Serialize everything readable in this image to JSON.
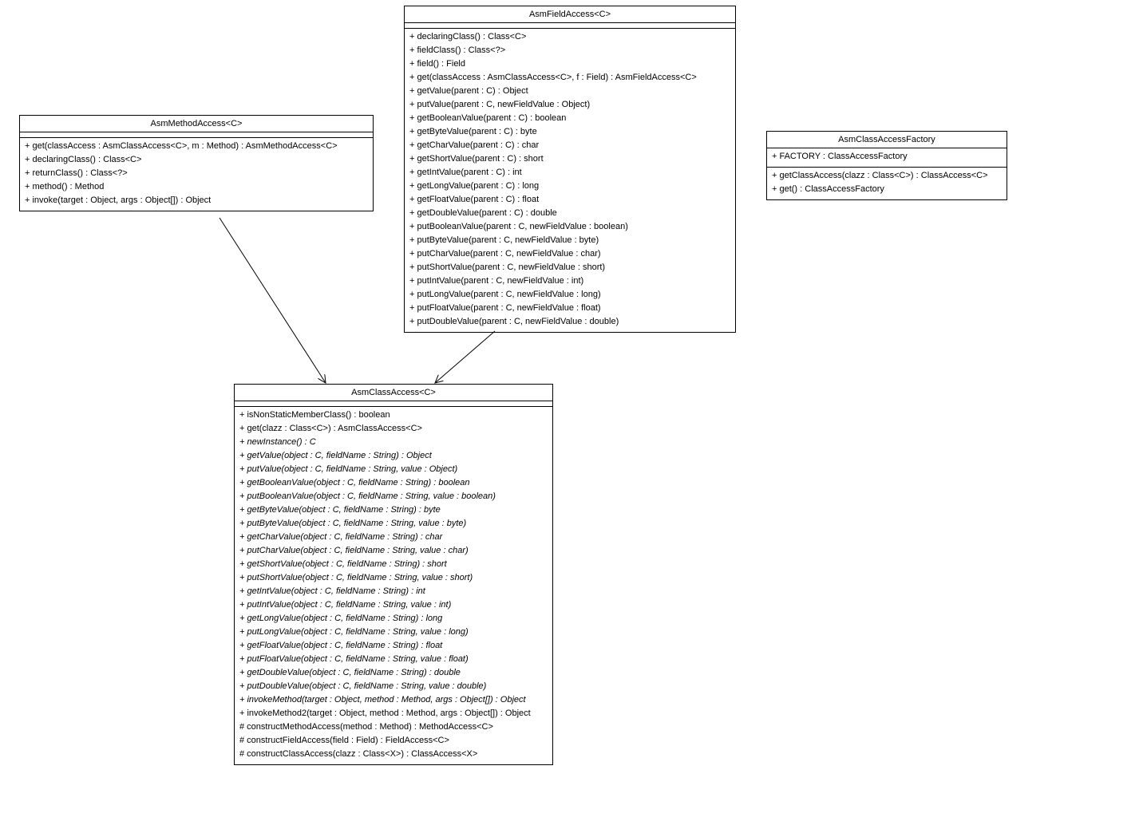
{
  "classes": {
    "asmMethodAccess": {
      "title": "AsmMethodAccess<C>",
      "ops": [
        {
          "text": "+ get(classAccess : AsmClassAccess<C>, m : Method) : AsmMethodAccess<C>",
          "italic": false
        },
        {
          "text": "+ declaringClass() : Class<C>",
          "italic": false
        },
        {
          "text": "+ returnClass() : Class<?>",
          "italic": false
        },
        {
          "text": "+ method() : Method",
          "italic": false
        },
        {
          "text": "+ invoke(target : Object, args : Object[]) : Object",
          "italic": false
        }
      ]
    },
    "asmFieldAccess": {
      "title": "AsmFieldAccess<C>",
      "ops": [
        {
          "text": "+ declaringClass() : Class<C>",
          "italic": false
        },
        {
          "text": "+ fieldClass() : Class<?>",
          "italic": false
        },
        {
          "text": "+ field() : Field",
          "italic": false
        },
        {
          "text": "+ get(classAccess : AsmClassAccess<C>, f : Field) : AsmFieldAccess<C>",
          "italic": false
        },
        {
          "text": "+ getValue(parent : C) : Object",
          "italic": false
        },
        {
          "text": "+ putValue(parent : C, newFieldValue : Object)",
          "italic": false
        },
        {
          "text": "+ getBooleanValue(parent : C) : boolean",
          "italic": false
        },
        {
          "text": "+ getByteValue(parent : C) : byte",
          "italic": false
        },
        {
          "text": "+ getCharValue(parent : C) : char",
          "italic": false
        },
        {
          "text": "+ getShortValue(parent : C) : short",
          "italic": false
        },
        {
          "text": "+ getIntValue(parent : C) : int",
          "italic": false
        },
        {
          "text": "+ getLongValue(parent : C) : long",
          "italic": false
        },
        {
          "text": "+ getFloatValue(parent : C) : float",
          "italic": false
        },
        {
          "text": "+ getDoubleValue(parent : C) : double",
          "italic": false
        },
        {
          "text": "+ putBooleanValue(parent : C, newFieldValue : boolean)",
          "italic": false
        },
        {
          "text": "+ putByteValue(parent : C, newFieldValue : byte)",
          "italic": false
        },
        {
          "text": "+ putCharValue(parent : C, newFieldValue : char)",
          "italic": false
        },
        {
          "text": "+ putShortValue(parent : C, newFieldValue : short)",
          "italic": false
        },
        {
          "text": "+ putIntValue(parent : C, newFieldValue : int)",
          "italic": false
        },
        {
          "text": "+ putLongValue(parent : C, newFieldValue : long)",
          "italic": false
        },
        {
          "text": "+ putFloatValue(parent : C, newFieldValue : float)",
          "italic": false
        },
        {
          "text": "+ putDoubleValue(parent : C, newFieldValue : double)",
          "italic": false
        }
      ]
    },
    "asmClassAccessFactory": {
      "title": "AsmClassAccessFactory",
      "attrs": [
        {
          "text": "+ FACTORY : ClassAccessFactory",
          "italic": false
        }
      ],
      "ops": [
        {
          "text": "+ getClassAccess(clazz : Class<C>) : ClassAccess<C>",
          "italic": false
        },
        {
          "text": "+ get() : ClassAccessFactory",
          "italic": false
        }
      ]
    },
    "asmClassAccess": {
      "title": "AsmClassAccess<C>",
      "ops": [
        {
          "text": "+ isNonStaticMemberClass() : boolean",
          "italic": false
        },
        {
          "text": "+ get(clazz : Class<C>) : AsmClassAccess<C>",
          "italic": false
        },
        {
          "text": "+ newInstance() : C",
          "italic": true
        },
        {
          "text": "+ getValue(object : C, fieldName : String) : Object",
          "italic": true
        },
        {
          "text": "+ putValue(object : C, fieldName : String, value : Object)",
          "italic": true
        },
        {
          "text": "+ getBooleanValue(object : C, fieldName : String) : boolean",
          "italic": true
        },
        {
          "text": "+ putBooleanValue(object : C, fieldName : String, value : boolean)",
          "italic": true
        },
        {
          "text": "+ getByteValue(object : C, fieldName : String) : byte",
          "italic": true
        },
        {
          "text": "+ putByteValue(object : C, fieldName : String, value : byte)",
          "italic": true
        },
        {
          "text": "+ getCharValue(object : C, fieldName : String) : char",
          "italic": true
        },
        {
          "text": "+ putCharValue(object : C, fieldName : String, value : char)",
          "italic": true
        },
        {
          "text": "+ getShortValue(object : C, fieldName : String) : short",
          "italic": true
        },
        {
          "text": "+ putShortValue(object : C, fieldName : String, value : short)",
          "italic": true
        },
        {
          "text": "+ getIntValue(object : C, fieldName : String) : int",
          "italic": true
        },
        {
          "text": "+ putIntValue(object : C, fieldName : String, value : int)",
          "italic": true
        },
        {
          "text": "+ getLongValue(object : C, fieldName : String) : long",
          "italic": true
        },
        {
          "text": "+ putLongValue(object : C, fieldName : String, value : long)",
          "italic": true
        },
        {
          "text": "+ getFloatValue(object : C, fieldName : String) : float",
          "italic": true
        },
        {
          "text": "+ putFloatValue(object : C, fieldName : String, value : float)",
          "italic": true
        },
        {
          "text": "+ getDoubleValue(object : C, fieldName : String) : double",
          "italic": true
        },
        {
          "text": "+ putDoubleValue(object : C, fieldName : String, value : double)",
          "italic": true
        },
        {
          "text": "+ invokeMethod(target : Object, method : Method, args : Object[]) : Object",
          "italic": true
        },
        {
          "text": "+ invokeMethod2(target : Object, method : Method, args : Object[]) : Object",
          "italic": false
        },
        {
          "text": "# constructMethodAccess(method : Method) : MethodAccess<C>",
          "italic": false
        },
        {
          "text": "# constructFieldAccess(field : Field) : FieldAccess<C>",
          "italic": false
        },
        {
          "text": "# constructClassAccess(clazz : Class<X>) : ClassAccess<X>",
          "italic": false
        }
      ]
    }
  }
}
